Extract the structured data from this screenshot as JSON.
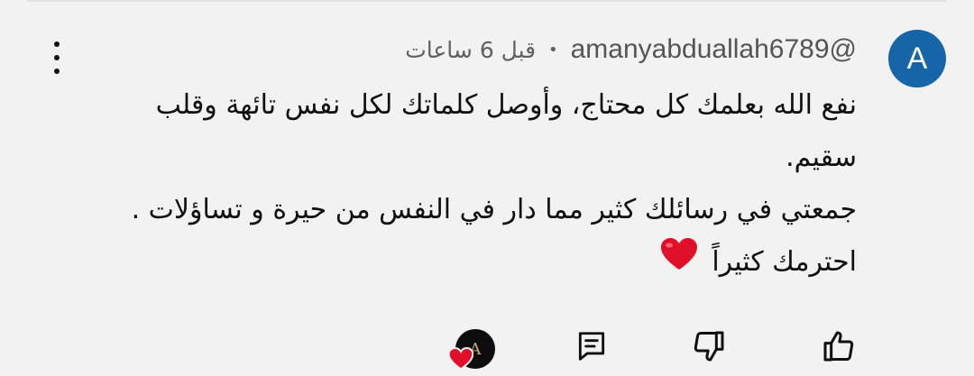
{
  "comment": {
    "avatar_letter": "A",
    "author_handle": "@amanyabduallah6789",
    "separator": "•",
    "timestamp": "قبل 6 ساعات",
    "lines": [
      "نفع الله بعلمك كل محتاج، وأوصل كلماتك لكل نفس تائهة وقلب",
      "سقيم.",
      "جمعتي في رسائلك كثير مما دار في النفس من حيرة و تساؤلات .",
      "احترمك كثيراً"
    ],
    "emoji": "red-heart"
  },
  "colors": {
    "avatar_bg": "#1565a8",
    "heart": "#e0102a",
    "background": "#f2f2f2"
  },
  "actions": {
    "like_icon": "thumbs-up-icon",
    "dislike_icon": "thumbs-down-icon",
    "reply_icon": "reply-comment-icon",
    "creator_heart_icon": "creator-heart-icon",
    "creator_avatar_letter": "A"
  },
  "menu_icon": "more-vertical-icon"
}
